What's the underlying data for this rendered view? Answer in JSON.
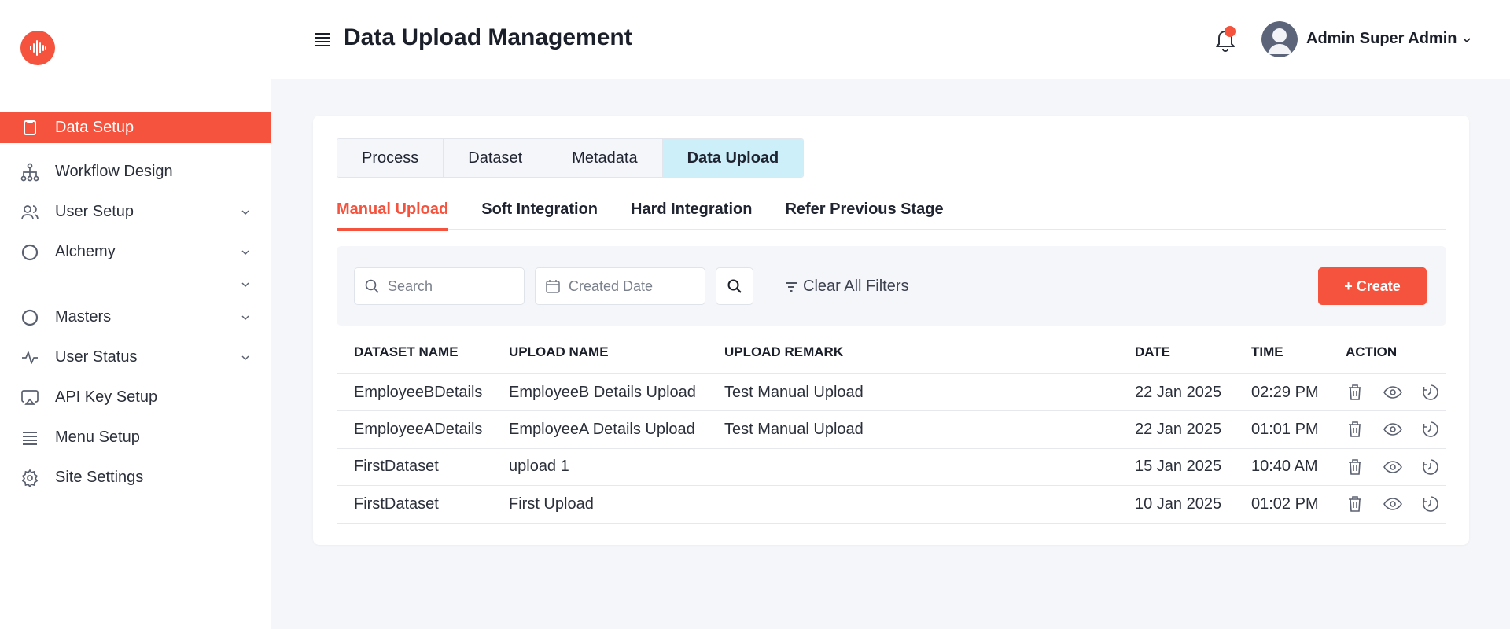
{
  "sidebar": {
    "items": [
      {
        "label": "Data Setup"
      },
      {
        "label": "Workflow Design"
      },
      {
        "label": "User Setup"
      },
      {
        "label": "Alchemy"
      },
      {
        "label": "Masters"
      },
      {
        "label": "User Status"
      },
      {
        "label": "API Key Setup"
      },
      {
        "label": "Menu Setup"
      },
      {
        "label": "Site Settings"
      }
    ]
  },
  "header": {
    "title": "Data Upload Management",
    "user_name": "Admin Super Admin"
  },
  "tabs": [
    "Process",
    "Dataset",
    "Metadata",
    "Data Upload"
  ],
  "subtabs": [
    "Manual Upload",
    "Soft Integration",
    "Hard Integration",
    "Refer Previous Stage"
  ],
  "filters": {
    "search_placeholder": "Search",
    "date_placeholder": "Created Date",
    "clear_label": "Clear All Filters",
    "create_label": "+ Create"
  },
  "table": {
    "headers": [
      "DATASET NAME",
      "UPLOAD NAME",
      "UPLOAD REMARK",
      "DATE",
      "TIME",
      "ACTION"
    ],
    "rows": [
      {
        "dataset": "EmployeeBDetails",
        "upload": "EmployeeB Details Upload",
        "remark": "Test Manual Upload",
        "date": "22 Jan 2025",
        "time": "02:29 PM"
      },
      {
        "dataset": "EmployeeADetails",
        "upload": "EmployeeA Details Upload",
        "remark": "Test Manual Upload",
        "date": "22 Jan 2025",
        "time": "01:01 PM"
      },
      {
        "dataset": "FirstDataset",
        "upload": "upload 1",
        "remark": "",
        "date": "15 Jan 2025",
        "time": "10:40 AM"
      },
      {
        "dataset": "FirstDataset",
        "upload": "First Upload",
        "remark": "",
        "date": "10 Jan 2025",
        "time": "01:02 PM"
      }
    ]
  },
  "colors": {
    "accent": "#f5533d",
    "active_tab": "#cdeffa"
  }
}
